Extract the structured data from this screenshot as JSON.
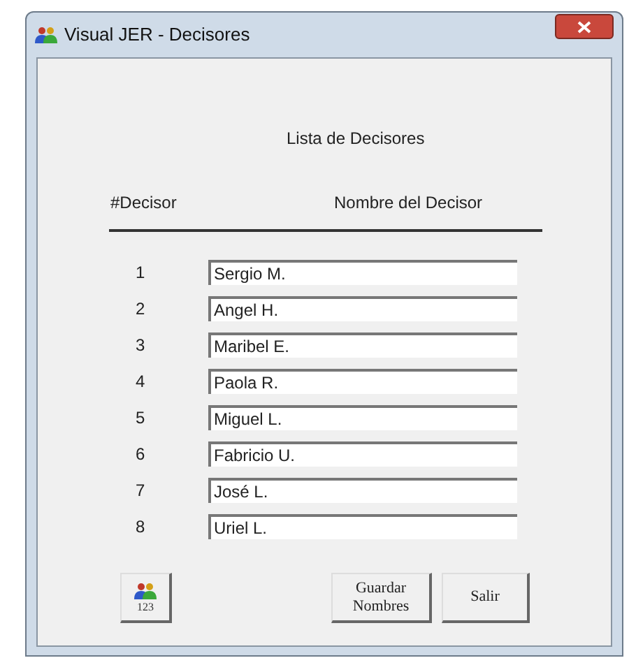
{
  "window": {
    "title": "Visual JER - Decisores"
  },
  "heading": "Lista de Decisores",
  "columns": [
    "#Decisor",
    "Nombre del Decisor"
  ],
  "rows": [
    {
      "number": "1",
      "name": "Sergio M."
    },
    {
      "number": "2",
      "name": "Angel H."
    },
    {
      "number": "3",
      "name": "Maribel E."
    },
    {
      "number": "4",
      "name": "Paola R."
    },
    {
      "number": "5",
      "name": "Miguel L."
    },
    {
      "number": "6",
      "name": "Fabricio U."
    },
    {
      "number": "7",
      "name": "José L."
    },
    {
      "number": "8",
      "name": "Uriel L."
    }
  ],
  "icon_button": {
    "label": "123"
  },
  "buttons": [
    "Guardar Nombres",
    "Salir"
  ]
}
